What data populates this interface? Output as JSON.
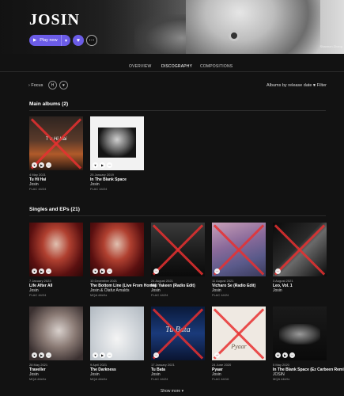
{
  "artist": {
    "name": "JOSIN"
  },
  "hero": {
    "photo_credit": "Shannon Zhang",
    "play_label": "Play now",
    "play_chevron": "▾",
    "heart_glyph": "♥",
    "more_glyph": "⋯",
    "accent": "#6b5ce7"
  },
  "tabs": [
    "OVERVIEW",
    "DISCOGRAPHY",
    "COMPOSITIONS"
  ],
  "active_tab": "DISCOGRAPHY",
  "filterbar": {
    "focus_label": "Focus",
    "focus_chevron": "›",
    "sort_label": "Albums by release date",
    "sort_chevron": "▾",
    "filter_label": "Filter",
    "filter_icon": "≡"
  },
  "main_albums": {
    "title": "Main albums (2)",
    "items": [
      {
        "date": "4 May 2021",
        "title": "Tu Hi Hai",
        "artist": "Josin",
        "format": "FLAC 44/24",
        "crossed": true
      },
      {
        "date": "25 January 2019",
        "title": "In The Blank Space",
        "artist": "Josin",
        "format": "FLAC 44/24",
        "crossed": false
      }
    ]
  },
  "singles": {
    "title": "Singles and EPs (21)",
    "items": [
      {
        "date": "7 January 2023",
        "title": "Life After All",
        "artist": "Josin",
        "format": "FLAC 44/24",
        "crossed": false
      },
      {
        "date": "10 December 2021",
        "title": "The Bottom Line (Live From Home)",
        "artist": "Josin & Ólafur Arnalds",
        "format": "MQA 44kHz",
        "crossed": false
      },
      {
        "date": "24 August 2021",
        "title": "Hai Yakeen (Radio Edit)",
        "artist": "Josin",
        "format": "FLAC 44/24",
        "crossed": true
      },
      {
        "date": "11 August 2021",
        "title": "Vicharo Se (Radio Edit)",
        "artist": "Josin",
        "format": "FLAC 44/24",
        "crossed": true
      },
      {
        "date": "3 August 2021",
        "title": "Leo, Vol. 1",
        "artist": "Josin",
        "format": "",
        "crossed": true
      },
      {
        "date": "28 May 2021",
        "title": "Traveller",
        "artist": "Josin",
        "format": "MQA 44kHz",
        "crossed": false
      },
      {
        "date": "9 April 2021",
        "title": "The Darkness",
        "artist": "Josin",
        "format": "MQA 44kHz",
        "crossed": false
      },
      {
        "date": "17 January 2021",
        "title": "Tu Bata",
        "artist": "Josin",
        "format": "FLAC 44/24",
        "crossed": true
      },
      {
        "date": "24 June 2020",
        "title": "Pyaar",
        "artist": "Josin",
        "format": "FLAC 44/16",
        "crossed": true
      },
      {
        "date": "5 May 2020",
        "title": "In The Blank Space (Ez Carbeen Remix)",
        "artist": "JOSIN",
        "format": "MQA 44kHz",
        "crossed": false
      }
    ]
  },
  "show_more": "Show more ▾"
}
